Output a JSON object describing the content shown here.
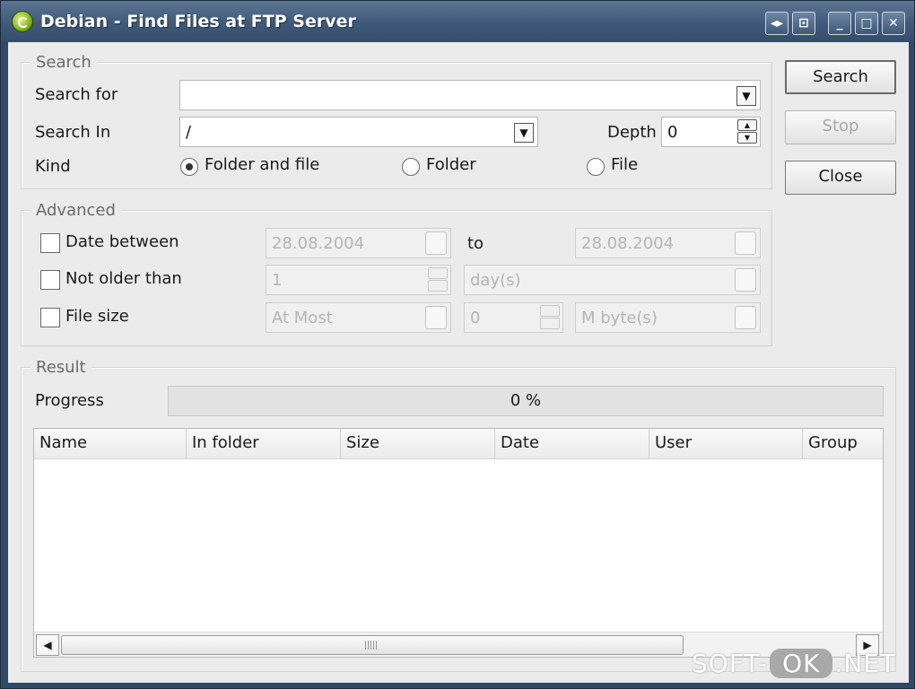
{
  "window": {
    "title": "Debian - Find Files at FTP Server",
    "controls": [
      "◂▸",
      "⊡",
      "_",
      "□",
      "✕"
    ]
  },
  "search": {
    "group_title": "Search",
    "search_for_label": "Search for",
    "search_for_value": "",
    "search_in_label": "Search In",
    "search_in_value": "/",
    "depth_label": "Depth",
    "depth_value": "0",
    "kind_label": "Kind",
    "kind_options": [
      "Folder and file",
      "Folder",
      "File"
    ],
    "kind_selected": "Folder and file"
  },
  "advanced": {
    "group_title": "Advanced",
    "date_between_label": "Date between",
    "date_from": "28.08.2004",
    "to_label": "to",
    "date_to": "28.08.2004",
    "not_older_label": "Not older than",
    "not_older_value": "1",
    "not_older_unit": "day(s)",
    "file_size_label": "File size",
    "file_size_mode": "At Most",
    "file_size_value": "0",
    "file_size_unit": "M byte(s)"
  },
  "result": {
    "group_title": "Result",
    "progress_label": "Progress",
    "progress_text": "0 %",
    "progress_value": 0,
    "columns": [
      "Name",
      "In folder",
      "Size",
      "Date",
      "User",
      "Group"
    ],
    "rows": []
  },
  "buttons": {
    "search": "Search",
    "stop": "Stop",
    "close": "Close"
  },
  "watermark": {
    "left": "SOFT-",
    "middle": "OK",
    "right": ".NET"
  }
}
